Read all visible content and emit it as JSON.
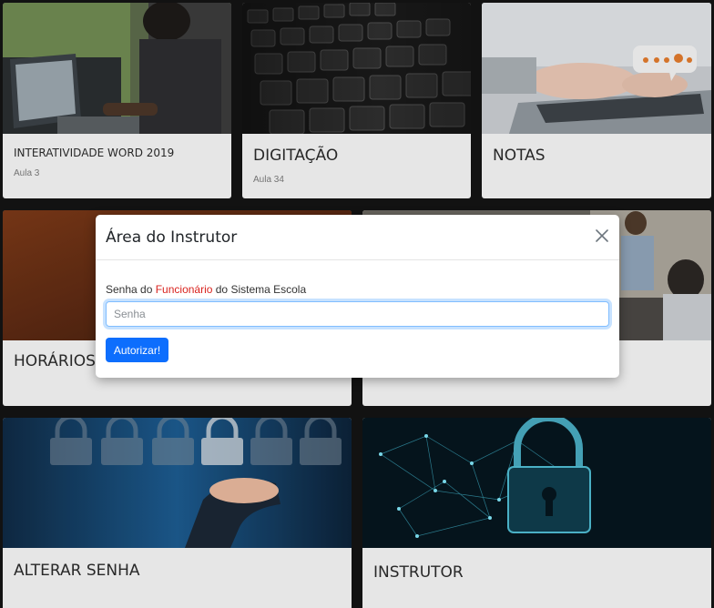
{
  "cards": [
    {
      "title": "INTERATIVIDADE WORD 2019",
      "subtitle": "Aula 3",
      "image": "woman-laptop-image"
    },
    {
      "title": "DIGITAÇÃO",
      "subtitle": "Aula 34",
      "image": "keyboard-image"
    },
    {
      "title": "NOTAS",
      "subtitle": "",
      "image": "typing-rating-image"
    },
    {
      "title": "HORÁRIOS",
      "subtitle": "",
      "image": "schedule-image"
    },
    {
      "title": "",
      "subtitle": "",
      "image": "classroom-image"
    },
    {
      "title": "ALTERAR SENHA",
      "subtitle": "",
      "image": "padlocks-image"
    },
    {
      "title": "INSTRUTOR",
      "subtitle": "",
      "image": "digital-lock-image"
    }
  ],
  "modal": {
    "title": "Área do Instrutor",
    "close_icon": "close-icon",
    "label_before": "Senha do ",
    "label_highlight": "Funcionário",
    "label_after": " do Sistema Escola",
    "input_placeholder": "Senha",
    "input_value": "",
    "submit_label": "Autorizar!"
  },
  "colors": {
    "primary_button": "#0d6efd",
    "highlight_text": "#d9231e",
    "card_background": "#f3f3f3",
    "page_background": "#141414"
  }
}
